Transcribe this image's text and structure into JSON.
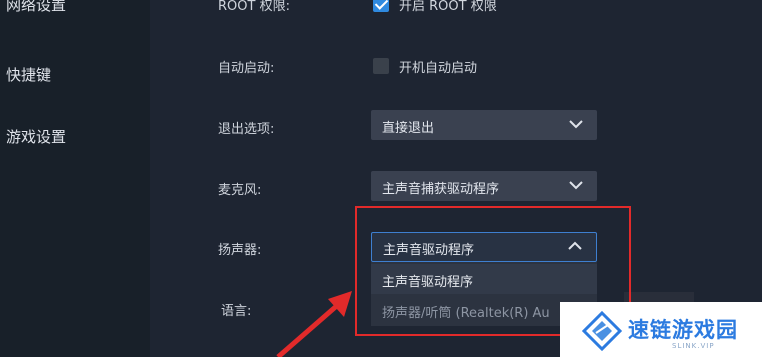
{
  "sidebar": {
    "items": [
      {
        "label": "网络设置"
      },
      {
        "label": "快捷键"
      },
      {
        "label": "游戏设置"
      }
    ]
  },
  "settings": {
    "root": {
      "label": "ROOT 权限:",
      "checkbox_label": "开启 ROOT 权限",
      "checked": true
    },
    "autostart": {
      "label": "自动启动:",
      "checkbox_label": "开机自动启动",
      "checked": false
    },
    "exit_option": {
      "label": "退出选项:",
      "value": "直接退出"
    },
    "microphone": {
      "label": "麦克风:",
      "value": "主声音捕获驱动程序"
    },
    "speaker": {
      "label": "扬声器:",
      "value": "主声音驱动程序",
      "options": [
        "主声音驱动程序",
        "扬声器/听筒 (Realtek(R) Au"
      ]
    },
    "language": {
      "label": "语言:"
    }
  },
  "watermark": {
    "title": "速链游戏园",
    "subtitle": "SLINK.VIP"
  },
  "colors": {
    "accent": "#2f8ae0",
    "highlight": "#e22a2a",
    "background": "#1e2532"
  }
}
